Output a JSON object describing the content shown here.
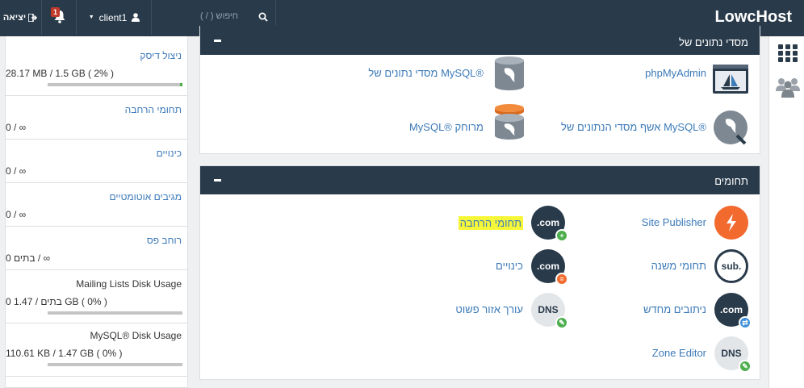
{
  "topbar": {
    "logout_label": "יציאה",
    "notification_count": "1",
    "username": "client1",
    "search_placeholder": "חיפוש ( / )",
    "brand": "LowcHost"
  },
  "stats": [
    {
      "title": "ניצול דיסק",
      "value": "28.17 MB / 1.5 GB ( 2% )",
      "progress_percent": 2
    },
    {
      "title": "תחומי הרחבה",
      "value": "0 / ∞"
    },
    {
      "title": "כינויים",
      "value": "0 / ∞"
    },
    {
      "title": "מגיבים אוטומטיים",
      "value": "0 / ∞"
    },
    {
      "title": "רוחב פס",
      "value": "0 בתים / ∞"
    },
    {
      "title": "Mailing Lists Disk Usage",
      "value": "0 בתים / 1.47 GB ( 0% )",
      "progress_percent": 0
    },
    {
      "title": "MySQL® Disk Usage",
      "value": "110.61 KB / 1.47 GB ( 0% )",
      "progress_percent": 0
    }
  ],
  "databases": {
    "title": "מסדי נתונים של",
    "items": [
      {
        "label": "phpMyAdmin",
        "icon": "phpmyadmin-icon"
      },
      {
        "label": "מסדי נתונים של MySQL®",
        "icon": "mysql-database-icon"
      },
      {
        "label": "אשף מסדי הנתונים של MySQL®",
        "icon": "mysql-wizard-icon"
      },
      {
        "label": "MySQL® מרוחק",
        "icon": "remote-mysql-icon"
      }
    ]
  },
  "domains": {
    "title": "תחומים",
    "items": [
      {
        "label": "Site Publisher",
        "icon": "site-publisher-icon",
        "icon_text": ""
      },
      {
        "label": "תחומי הרחבה",
        "icon": "addon-domains-icon",
        "icon_text": ".com"
      },
      {
        "label": "תחומי משנה",
        "icon": "subdomains-icon",
        "icon_text": "sub."
      },
      {
        "label": "כינויים",
        "icon": "aliases-icon",
        "icon_text": ".com"
      },
      {
        "label": "ניתובים מחדש",
        "icon": "redirects-icon",
        "icon_text": ".com"
      },
      {
        "label": "עורך אזור פשוט",
        "icon": "simple-zone-editor-icon",
        "icon_text": "DNS"
      },
      {
        "label": "Zone Editor",
        "icon": "zone-editor-icon",
        "icon_text": "DNS"
      }
    ]
  },
  "colors": {
    "topbar": "#293a4a",
    "link": "#3c7ab8",
    "site_publisher": "#f26a2e",
    "highlight": "#f7f73a",
    "progress": "#4cae4c"
  }
}
